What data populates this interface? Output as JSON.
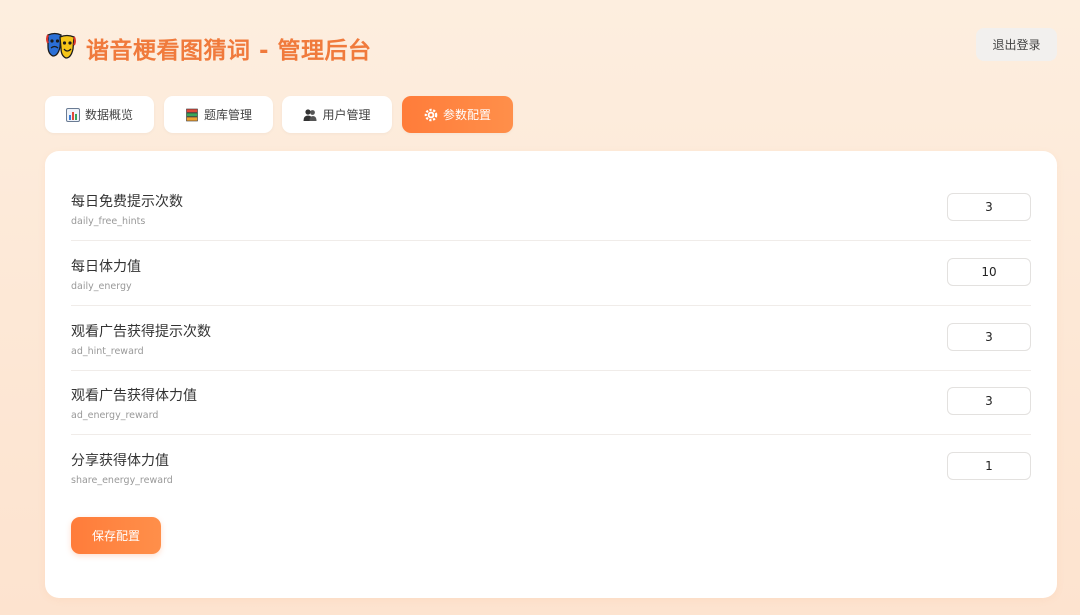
{
  "header": {
    "logo_icon": "theater-masks-icon",
    "title": "谐音梗看图猜词 - 管理后台",
    "logout_label": "退出登录"
  },
  "tabs": [
    {
      "label": "数据概览",
      "icon": "bar-chart-icon",
      "active": false
    },
    {
      "label": "题库管理",
      "icon": "books-icon",
      "active": false
    },
    {
      "label": "用户管理",
      "icon": "users-icon",
      "active": false
    },
    {
      "label": "参数配置",
      "icon": "gear-icon",
      "active": true
    }
  ],
  "config": {
    "rows": [
      {
        "label": "每日免费提示次数",
        "key": "daily_free_hints",
        "value": "3"
      },
      {
        "label": "每日体力值",
        "key": "daily_energy",
        "value": "10"
      },
      {
        "label": "观看广告获得提示次数",
        "key": "ad_hint_reward",
        "value": "3"
      },
      {
        "label": "观看广告获得体力值",
        "key": "ad_energy_reward",
        "value": "3"
      },
      {
        "label": "分享获得体力值",
        "key": "share_energy_reward",
        "value": "1"
      }
    ],
    "save_label": "保存配置"
  },
  "colors": {
    "accent": "#ff7c3a",
    "title": "#f07a3c",
    "background": "#fdeedf"
  }
}
